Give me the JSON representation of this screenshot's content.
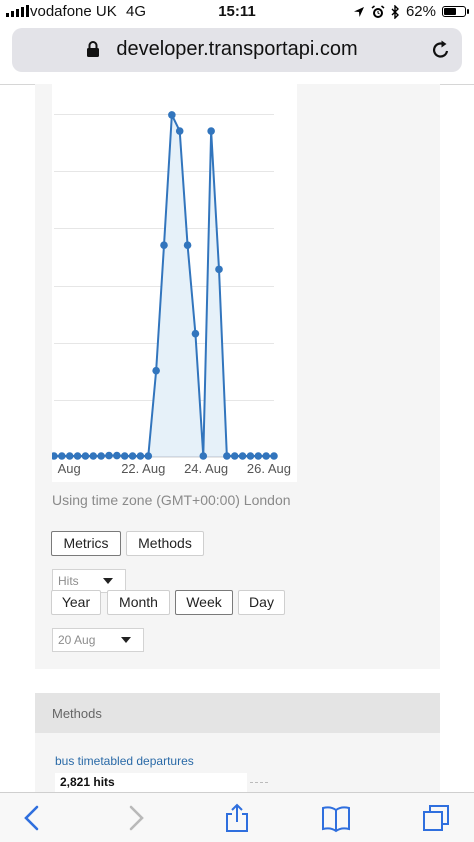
{
  "status_bar": {
    "carrier": "vodafone UK",
    "network": "4G",
    "time": "15:11",
    "battery": "62%",
    "battery_level": 0.62
  },
  "browser": {
    "url": "developer.transportapi.com"
  },
  "chart_data": {
    "type": "area",
    "x_tick_labels": [
      "Aug",
      "22. Aug",
      "24. Aug",
      "26. Aug"
    ],
    "grid": true,
    "x": [
      0,
      1,
      2,
      3,
      4,
      5,
      6,
      7,
      8,
      9,
      10,
      11,
      12,
      13,
      14,
      15,
      16,
      17,
      18,
      19,
      20,
      21,
      22,
      23,
      24,
      25,
      26,
      27,
      28
    ],
    "values": [
      0,
      0,
      0,
      0,
      0,
      0,
      0,
      0.03,
      0.03,
      0,
      0,
      0,
      0,
      5.3,
      13.1,
      21.2,
      20.2,
      13.1,
      7.6,
      0,
      20.2,
      11.6,
      0,
      0,
      0,
      0,
      0,
      0,
      0
    ],
    "series_color": "#3275bd",
    "fill_color": "#e6f1f9"
  },
  "timezone_note": "Using time zone (GMT+00:00) London",
  "view_tabs": [
    {
      "label": "Metrics",
      "active": true
    },
    {
      "label": "Methods",
      "active": false
    }
  ],
  "metric_select": {
    "value": "Hits"
  },
  "period_tabs": [
    {
      "label": "Year",
      "active": false
    },
    {
      "label": "Month",
      "active": false
    },
    {
      "label": "Week",
      "active": true
    },
    {
      "label": "Day",
      "active": false
    }
  ],
  "date_select": {
    "value": "20 Aug"
  },
  "methods_section": {
    "title": "Methods",
    "items": [
      {
        "name": "bus timetabled departures",
        "hits": "2,821 hits"
      }
    ]
  },
  "toolbar": {
    "icons": [
      "back-icon",
      "forward-icon",
      "share-icon",
      "bookmarks-icon",
      "tabs-icon"
    ]
  }
}
